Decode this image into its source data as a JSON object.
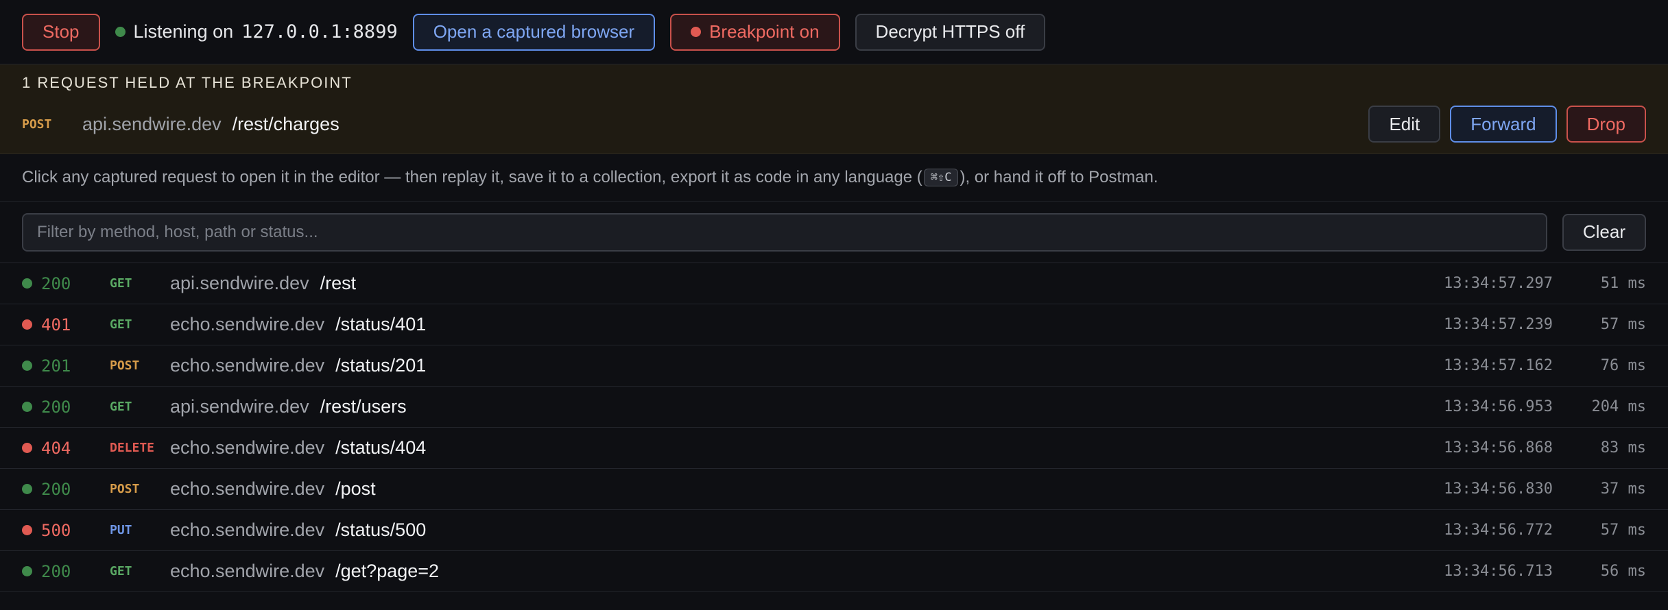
{
  "toolbar": {
    "stop_label": "Stop",
    "listening_prefix": "Listening on",
    "listening_address": "127.0.0.1:8899",
    "open_browser_label": "Open a captured browser",
    "breakpoint_label": "Breakpoint on",
    "decrypt_label": "Decrypt HTTPS off"
  },
  "breakpoint": {
    "title": "1 REQUEST HELD AT THE BREAKPOINT",
    "method": "POST",
    "host": "api.sendwire.dev",
    "path": "/rest/charges",
    "edit_label": "Edit",
    "forward_label": "Forward",
    "drop_label": "Drop"
  },
  "info": {
    "text_before": "Click any captured request to open it in the editor — then replay it, save it to a collection, export it as code in any language (",
    "shortcut": "⌘⇧C",
    "text_after": "), or hand it off to Postman."
  },
  "filter": {
    "placeholder": "Filter by method, host, path or status...",
    "value": "",
    "clear_label": "Clear"
  },
  "requests": [
    {
      "status": "200",
      "method": "GET",
      "host": "api.sendwire.dev",
      "path": "/rest",
      "time": "13:34:57.297",
      "duration": "51 ms"
    },
    {
      "status": "401",
      "method": "GET",
      "host": "echo.sendwire.dev",
      "path": "/status/401",
      "time": "13:34:57.239",
      "duration": "57 ms"
    },
    {
      "status": "201",
      "method": "POST",
      "host": "echo.sendwire.dev",
      "path": "/status/201",
      "time": "13:34:57.162",
      "duration": "76 ms"
    },
    {
      "status": "200",
      "method": "GET",
      "host": "api.sendwire.dev",
      "path": "/rest/users",
      "time": "13:34:56.953",
      "duration": "204 ms"
    },
    {
      "status": "404",
      "method": "DELETE",
      "host": "echo.sendwire.dev",
      "path": "/status/404",
      "time": "13:34:56.868",
      "duration": "83 ms"
    },
    {
      "status": "200",
      "method": "POST",
      "host": "echo.sendwire.dev",
      "path": "/post",
      "time": "13:34:56.830",
      "duration": "37 ms"
    },
    {
      "status": "500",
      "method": "PUT",
      "host": "echo.sendwire.dev",
      "path": "/status/500",
      "time": "13:34:56.772",
      "duration": "57 ms"
    },
    {
      "status": "200",
      "method": "GET",
      "host": "echo.sendwire.dev",
      "path": "/get?page=2",
      "time": "13:34:56.713",
      "duration": "56 ms"
    }
  ]
}
